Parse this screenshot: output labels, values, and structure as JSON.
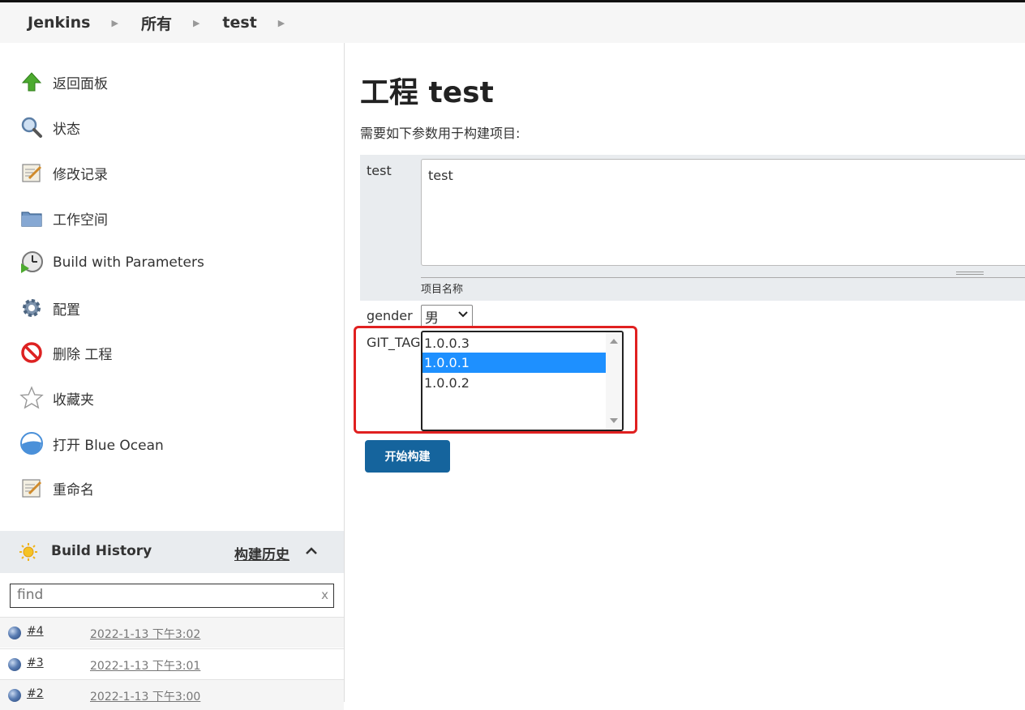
{
  "breadcrumb": [
    "Jenkins",
    "所有",
    "test"
  ],
  "sidebar": {
    "tasks": [
      {
        "label": "返回面板",
        "icon": "up-arrow-icon"
      },
      {
        "label": "状态",
        "icon": "magnifier-icon"
      },
      {
        "label": "修改记录",
        "icon": "notepad-icon"
      },
      {
        "label": "工作空间",
        "icon": "folder-icon"
      },
      {
        "label": "Build with Parameters",
        "icon": "clock-build-icon"
      },
      {
        "label": "配置",
        "icon": "gear-icon"
      },
      {
        "label": "删除 工程",
        "icon": "no-entry-icon"
      },
      {
        "label": "收藏夹",
        "icon": "star-icon"
      },
      {
        "label": "打开 Blue Ocean",
        "icon": "blue-ocean-icon"
      },
      {
        "label": "重命名",
        "icon": "notepad-icon"
      }
    ]
  },
  "build_history": {
    "title": "Build History",
    "link": "构建历史",
    "search_placeholder": "find",
    "clear": "x",
    "builds": [
      {
        "number": "#4",
        "date": "2022-1-13 下午3:02"
      },
      {
        "number": "#3",
        "date": "2022-1-13 下午3:01"
      },
      {
        "number": "#2",
        "date": "2022-1-13 下午3:00"
      }
    ]
  },
  "main": {
    "title": "工程 test",
    "description": "需要如下参数用于构建项目:",
    "params": {
      "test": {
        "label": "test",
        "value": "test",
        "hint": "项目名称"
      },
      "gender": {
        "label": "gender",
        "value": "男"
      },
      "git_tag": {
        "label": "GIT_TAG",
        "options": [
          "1.0.0.3",
          "1.0.0.1",
          "1.0.0.2"
        ],
        "selected": "1.0.0.1"
      }
    },
    "build_button": "开始构建"
  },
  "colors": {
    "accent_button": "#15649d",
    "selection": "#1e90ff",
    "highlight": "#e02020"
  }
}
